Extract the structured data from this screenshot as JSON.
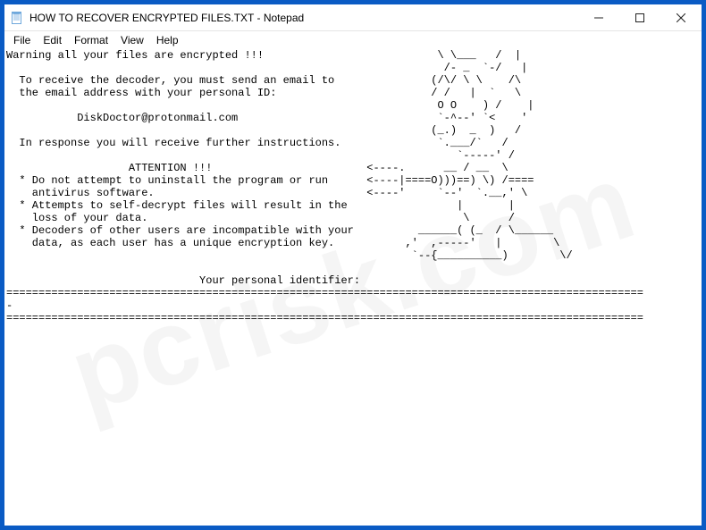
{
  "titlebar": {
    "title": "HOW TO RECOVER ENCRYPTED FILES.TXT - Notepad"
  },
  "menubar": {
    "items": [
      "File",
      "Edit",
      "Format",
      "View",
      "Help"
    ]
  },
  "document": {
    "body": "Warning all your files are encrypted !!!                           \\ \\___   /  |\n                                                                    /- _  `-/   |\n  To receive the decoder, you must send an email to               (/\\/ \\ \\    /\\\n  the email address with your personal ID:                        / /   |  `   \\\n                                                                   O O    ) /    |\n           DiskDoctor@protonmail.com                               `-^--' `<    '\n                                                                  (_.)  _  )   /\n  In response you will receive further instructions.               `.___/`   /\n                                                                      `-----' /\n                   ATTENTION !!!                        <----.      __ / __  \\\n  * Do not attempt to uninstall the program or run      <----|====O)))==) \\) /====\n    antivirus software.                                 <----'     `--'  `.__,' \\\n  * Attempts to self-decrypt files will result in the                 |       |\n    loss of your data.                                                 \\      /\n  * Decoders of other users are incompatible with your          ______( (_  / \\______\n    data, as each user has a unique encryption key.           ,'  ,-----'   |        \\\n                                                               `--{__________)        \\/\n\n                              Your personal identifier:\n===================================================================================================\n-\n==================================================================================================="
  },
  "watermark": {
    "text": "pcrisk.com"
  }
}
